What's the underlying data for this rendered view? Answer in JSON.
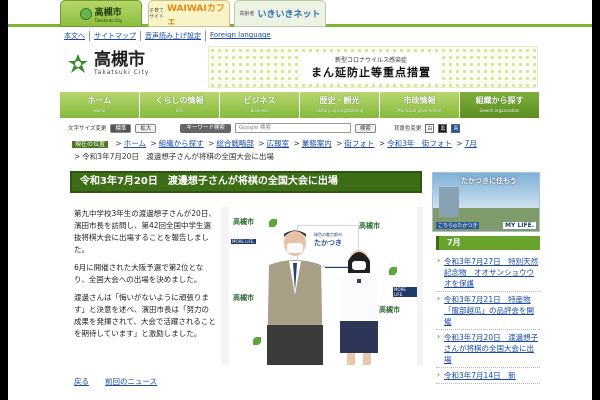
{
  "site_tabs": {
    "main_label": "高槻市",
    "main_sub": "Takatsuki City",
    "waiwai_small": "子育て\nサイト",
    "waiwai_label": "WAIWAIカフェ",
    "iki_small": "高齢者",
    "iki_label": "いきいきネット"
  },
  "util_links": [
    "本文へ",
    "サイトマップ",
    "音声読み上げ設定",
    "Foreign language"
  ],
  "logo": {
    "title": "高槻市",
    "sub": "Takatsuki City"
  },
  "banner": {
    "small": "新型コロナウイルス感染症",
    "big": "まん延防止等重点措置"
  },
  "gnav": [
    {
      "label": "ホーム",
      "en": "Home"
    },
    {
      "label": "くらしの情報",
      "en": "Life"
    },
    {
      "label": "ビジネス",
      "en": "Business"
    },
    {
      "label": "歴史・観光",
      "en": "History and sightseeing"
    },
    {
      "label": "市政情報",
      "en": "Municipal government"
    },
    {
      "label": "組織から探す",
      "en": "Search organization"
    }
  ],
  "tools": {
    "font_size_label": "文字サイズ変更",
    "standard": "標準",
    "enlarge": "拡大",
    "keyword_label": "キーワード検索",
    "search_placeholder": "Google 検索",
    "search_button": "検索",
    "bg_label": "背景色変更",
    "bg_white": "白",
    "bg_black": "黒",
    "bg_blue": "青"
  },
  "breadcrumb": {
    "here_label": "現在の位置",
    "items": [
      "ホーム",
      "組織から探す",
      "総合戦略部",
      "広報室",
      "業務案内",
      "街フォト",
      "令和3年　街フォト",
      "7月"
    ],
    "current": "令和3年7月20日　渡邊想子さんが将棋の全国大会に出場"
  },
  "article": {
    "title": "令和3年7月20日　渡邊想子さんが将棋の全国大会に出場",
    "paragraphs": [
      "第九中学校3年生の渡邊想子さんが20日、濱田市長を訪問し、第42回全国中学生選抜将棋大会に出場することを報告しました。",
      "6月に開催された大阪予選で第2位となり、全国大会への出場を決めました。",
      "渡邊さんは「悔いがないように頑張ります」と決意を述べ、濱田市長は「努力の成果を発揮されて、大会で活躍されることを期待しています」と激励しました。"
    ],
    "back_link": "戻る",
    "prev_link": "前回のニュース"
  },
  "photo": {
    "backdrop_text": "高槻市",
    "tag_text": "MORE LIFE.",
    "poster_small": "緑色の魅力都市",
    "poster_big": "たかつき"
  },
  "sidebar": {
    "banner_title": "たかつきに住もう",
    "banner_logo": "MY LIFE.",
    "banner_foot": "こちら◎たかつき",
    "month": "7月",
    "items": [
      "令和3年7月27日　特別天然記念物　オオサンショウウオを保護",
      "令和3年7月21日　特産物「服部越瓜」の品評会を開催",
      "令和3年7月20日　渡邊想子さんが将棋の全国大会に出場",
      "令和3年7月14日　新"
    ]
  },
  "colors": {
    "accent": "#3e6d18",
    "nav": "#86ba3c",
    "link": "#1a4aa6"
  }
}
